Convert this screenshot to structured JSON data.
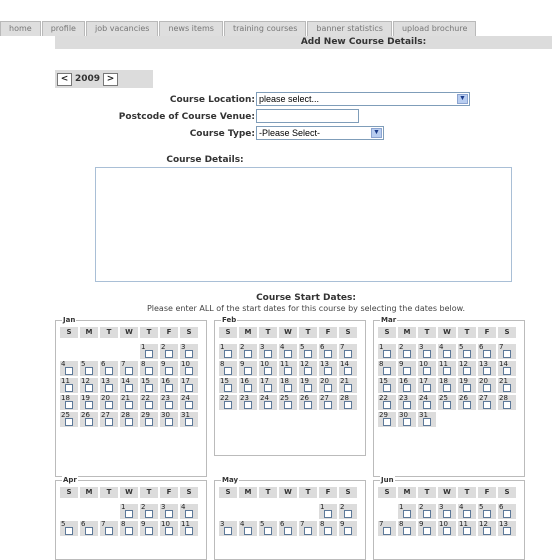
{
  "tabs": [
    "home",
    "profile",
    "job vacancies",
    "news items",
    "training courses",
    "banner statistics",
    "upload brochure"
  ],
  "page_title": "Add New Course Details:",
  "year": {
    "prev": "<",
    "value": "2009",
    "next": ">"
  },
  "form": {
    "location_label": "Course Location:",
    "location_value": "please select...",
    "postcode_label": "Postcode of Course Venue:",
    "type_label": "Course Type:",
    "type_value": "-Please Select-",
    "details_label": "Course Details:"
  },
  "start": {
    "title": "Course Start Dates:",
    "instruction": "Please enter ALL of the start dates for this course by selecting the dates below."
  },
  "day_headers": [
    "S",
    "M",
    "T",
    "W",
    "T",
    "F",
    "S"
  ],
  "months": [
    {
      "name": "Jan",
      "offset": 4,
      "days": 31
    },
    {
      "name": "Feb",
      "offset": 0,
      "days": 28
    },
    {
      "name": "Mar",
      "offset": 0,
      "days": 31
    },
    {
      "name": "Apr",
      "offset": 3,
      "days": 11
    },
    {
      "name": "May",
      "offset": 5,
      "days": 9
    },
    {
      "name": "Jun",
      "offset": 1,
      "days": 13
    }
  ]
}
